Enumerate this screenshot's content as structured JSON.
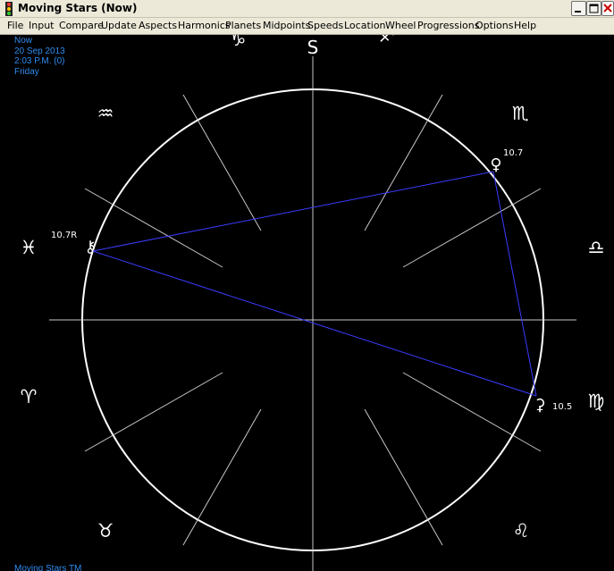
{
  "window": {
    "title": "Moving Stars (Now)",
    "controls": {
      "minimize": "minimize",
      "maximize": "maximize",
      "close": "close"
    }
  },
  "menu": [
    "File",
    "Input",
    "Compare",
    "Update",
    "Aspects",
    "Harmonics",
    "Planets",
    "Midpoints",
    "Speeds",
    "Location",
    "Wheel",
    "Progressions",
    "Options",
    "Help"
  ],
  "chart_info": {
    "label": "Now",
    "date": "20 Sep 2013",
    "time": "2:03 P.M. (0)",
    "weekday": "Friday"
  },
  "wheel": {
    "top_marker": "S",
    "signs": [
      {
        "name": "capricorn",
        "glyph": "♑"
      },
      {
        "name": "sagittarius",
        "glyph": "♐"
      },
      {
        "name": "aquarius",
        "glyph": "♒"
      },
      {
        "name": "scorpio",
        "glyph": "♏"
      },
      {
        "name": "pisces",
        "glyph": "♓"
      },
      {
        "name": "libra",
        "glyph": "♎"
      },
      {
        "name": "aries",
        "glyph": "♈"
      },
      {
        "name": "virgo",
        "glyph": "♍"
      },
      {
        "name": "taurus",
        "glyph": "♉"
      },
      {
        "name": "leo",
        "glyph": "♌"
      }
    ],
    "planets": [
      {
        "name": "venus",
        "glyph": "♀",
        "label": "10.7"
      },
      {
        "name": "chiron",
        "glyph": "⚷",
        "label": "10.7R"
      },
      {
        "name": "ceres",
        "glyph": "⚳",
        "label": "10.5"
      }
    ],
    "colors": {
      "circle": "#ffffff",
      "spokes": "#c8c8c8",
      "aspects": "#3b3bff",
      "info_text": "#2f8cf0"
    }
  },
  "footer": "Moving Stars TM"
}
